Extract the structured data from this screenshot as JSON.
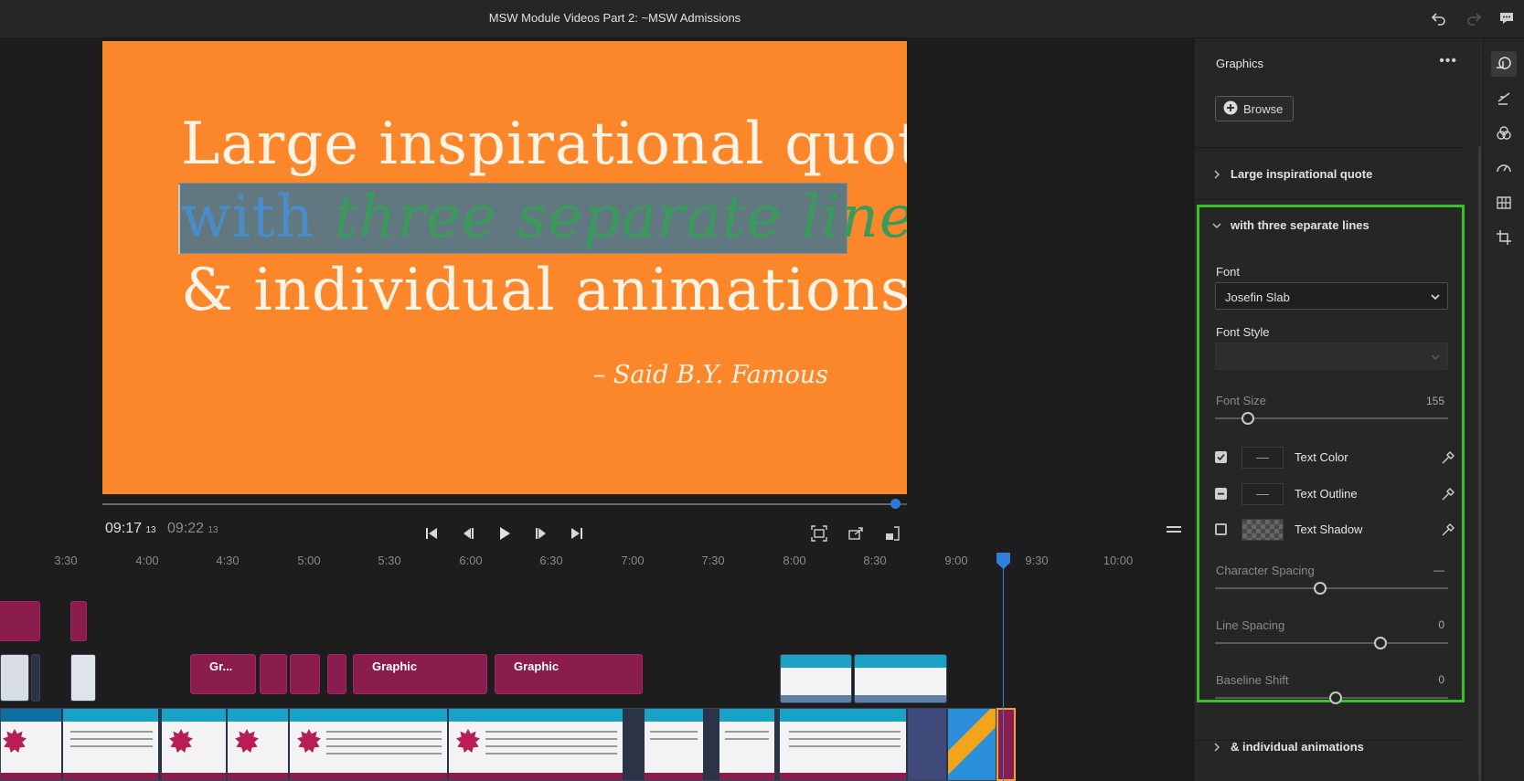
{
  "window": {
    "title": "MSW Module Videos Part 2: ~MSW Admissions"
  },
  "titlebar_icons": [
    "undo-icon",
    "redo-icon",
    "feedback-icon"
  ],
  "preview": {
    "background_color": "#fb872a",
    "line1": "Large inspirational quote",
    "line2_part1": "with ",
    "line2_part2": "three separate lines",
    "line3": "& individual animations",
    "attribution": "– Said B.Y. Famous"
  },
  "transport": {
    "current_time": "09:17",
    "current_frames": "13",
    "duration_time": "09:22",
    "duration_frames": "13",
    "progress_fraction": 0.985
  },
  "timeline": {
    "ruler": [
      "3:30",
      "4:00",
      "4:30",
      "5:00",
      "5:30",
      "6:00",
      "6:30",
      "7:00",
      "7:30",
      "8:00",
      "8:30",
      "9:00",
      "9:30",
      "10:00"
    ],
    "graphic_clips": [
      "Gr...",
      "",
      "",
      "",
      "Graphic",
      "Graphic"
    ]
  },
  "graphics_panel": {
    "header": "Graphics",
    "browse_label": "Browse",
    "sections": {
      "line1": "Large inspirational quote",
      "line2": "with three separate lines",
      "line3": "& individual animations"
    },
    "font_label": "Font",
    "font_value": "Josefin Slab",
    "font_style_label": "Font Style",
    "font_style_value": "",
    "font_size_label": "Font Size",
    "font_size_value": "155",
    "font_size_level": 0.12,
    "text_color_label": "Text Color",
    "text_color_checked": true,
    "text_outline_label": "Text Outline",
    "text_outline_checked": "mixed",
    "text_shadow_label": "Text Shadow",
    "text_shadow_checked": false,
    "character_spacing_label": "Character Spacing",
    "character_spacing_value": "—",
    "character_spacing_level": 0.45,
    "line_spacing_label": "Line Spacing",
    "line_spacing_value": "0",
    "line_spacing_level": 0.72,
    "baseline_shift_label": "Baseline Shift",
    "baseline_shift_value": "0",
    "baseline_shift_level": 0.52,
    "highlight_color": "#3cbf2c"
  },
  "right_toolbar": [
    "graphics-icon",
    "effects-icon",
    "color-icon",
    "speed-icon",
    "adjust-icon",
    "crop-icon"
  ]
}
